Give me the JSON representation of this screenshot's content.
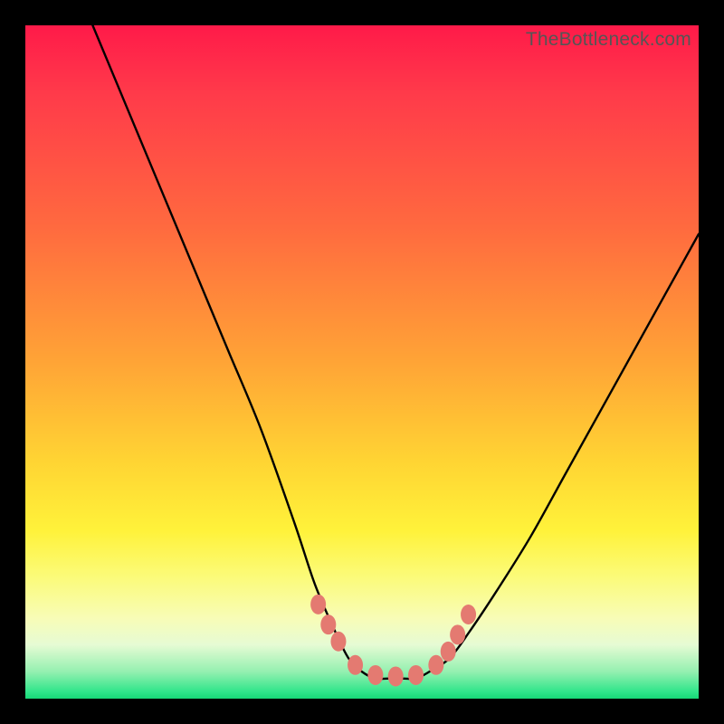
{
  "watermark": "TheBottleneck.com",
  "colors": {
    "frame": "#000000",
    "gradient_top": "#ff1a49",
    "gradient_mid": "#ffd533",
    "gradient_bottom": "#17d877",
    "curve": "#000000",
    "marker": "#e47a71"
  },
  "chart_data": {
    "type": "line",
    "title": "",
    "xlabel": "",
    "ylabel": "",
    "xlim": [
      0,
      100
    ],
    "ylim": [
      0,
      100
    ],
    "series": [
      {
        "name": "bottleneck-curve",
        "x": [
          10,
          15,
          20,
          25,
          30,
          35,
          40,
          43,
          46,
          48,
          50,
          52,
          54,
          56,
          58,
          60,
          63,
          66,
          70,
          75,
          80,
          85,
          90,
          95,
          100
        ],
        "y": [
          100,
          88,
          76,
          64,
          52,
          40,
          26,
          17,
          10,
          6,
          4,
          3,
          3,
          3,
          3,
          4,
          6,
          10,
          16,
          24,
          33,
          42,
          51,
          60,
          69
        ]
      }
    ],
    "markers": {
      "name": "highlight-dots",
      "x": [
        43.5,
        45.0,
        46.5,
        49.0,
        52.0,
        55.0,
        58.0,
        61.0,
        62.8,
        64.2,
        65.8
      ],
      "y": [
        14.0,
        11.0,
        8.5,
        5.0,
        3.5,
        3.3,
        3.5,
        5.0,
        7.0,
        9.5,
        12.5
      ]
    }
  }
}
